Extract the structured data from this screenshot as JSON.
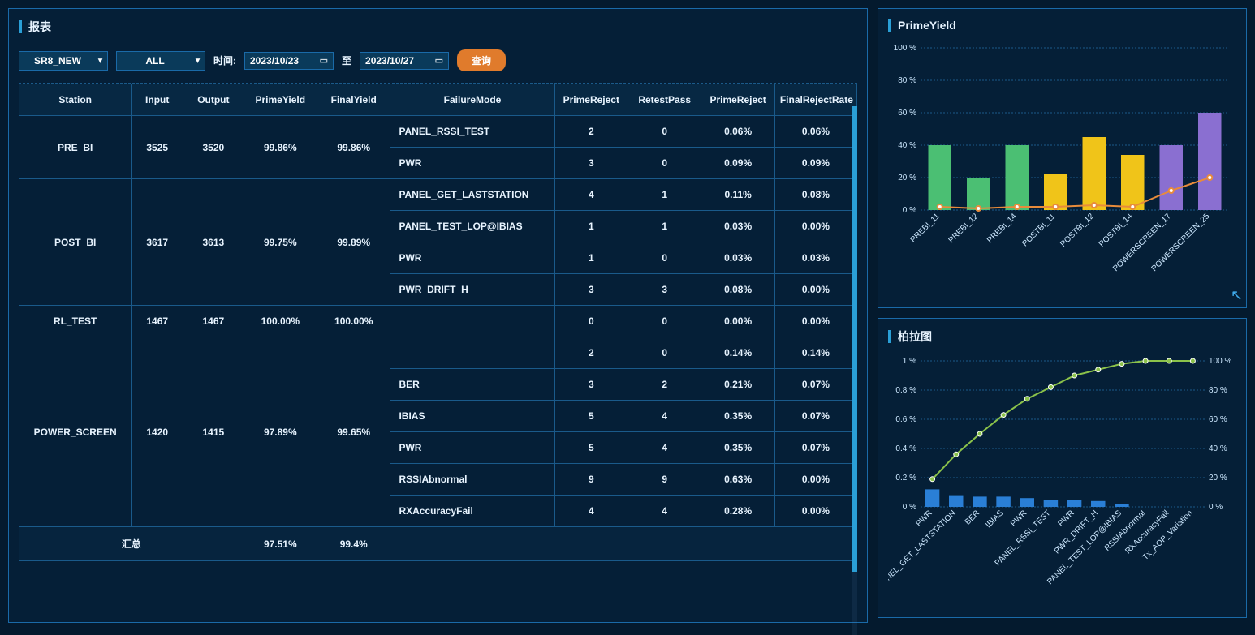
{
  "report": {
    "title": "报表",
    "filters": {
      "source": "SR8_NEW",
      "scope": "ALL",
      "time_label": "时间:",
      "date_from": "2023/10/23",
      "date_sep": "至",
      "date_to": "2023/10/27",
      "query_btn": "查询"
    },
    "columns": [
      "Station",
      "Input",
      "Output",
      "PrimeYield",
      "FinalYield",
      "FailureMode",
      "PrimeReject",
      "RetestPass",
      "PrimeReject",
      "FinalRejectRate"
    ],
    "rows": [
      {
        "station": "PRE_BI",
        "input": "3525",
        "output": "3520",
        "prime_yield": "99.86%",
        "final_yield": "99.86%",
        "details": [
          {
            "fm": "PANEL_RSSI_TEST",
            "pr": "2",
            "rp": "0",
            "pr2": "0.06%",
            "frr": "0.06%"
          },
          {
            "fm": "PWR",
            "pr": "3",
            "rp": "0",
            "pr2": "0.09%",
            "frr": "0.09%"
          }
        ]
      },
      {
        "station": "POST_BI",
        "input": "3617",
        "output": "3613",
        "prime_yield": "99.75%",
        "final_yield": "99.89%",
        "details": [
          {
            "fm": "PANEL_GET_LASTSTATION",
            "pr": "4",
            "rp": "1",
            "pr2": "0.11%",
            "frr": "0.08%"
          },
          {
            "fm": "PANEL_TEST_LOP@IBIAS",
            "pr": "1",
            "rp": "1",
            "pr2": "0.03%",
            "frr": "0.00%"
          },
          {
            "fm": "PWR",
            "pr": "1",
            "rp": "0",
            "pr2": "0.03%",
            "frr": "0.03%"
          },
          {
            "fm": "PWR_DRIFT_H",
            "pr": "3",
            "rp": "3",
            "pr2": "0.08%",
            "frr": "0.00%"
          }
        ]
      },
      {
        "station": "RL_TEST",
        "input": "1467",
        "output": "1467",
        "prime_yield": "100.00%",
        "final_yield": "100.00%",
        "details": [
          {
            "fm": "",
            "pr": "0",
            "rp": "0",
            "pr2": "0.00%",
            "frr": "0.00%"
          }
        ]
      },
      {
        "station": "POWER_SCREEN",
        "input": "1420",
        "output": "1415",
        "prime_yield": "97.89%",
        "final_yield": "99.65%",
        "details": [
          {
            "fm": "",
            "pr": "2",
            "rp": "0",
            "pr2": "0.14%",
            "frr": "0.14%"
          },
          {
            "fm": "BER",
            "pr": "3",
            "rp": "2",
            "pr2": "0.21%",
            "frr": "0.07%"
          },
          {
            "fm": "IBIAS",
            "pr": "5",
            "rp": "4",
            "pr2": "0.35%",
            "frr": "0.07%"
          },
          {
            "fm": "PWR",
            "pr": "5",
            "rp": "4",
            "pr2": "0.35%",
            "frr": "0.07%"
          },
          {
            "fm": "RSSIAbnormal",
            "pr": "9",
            "rp": "9",
            "pr2": "0.63%",
            "frr": "0.00%"
          },
          {
            "fm": "RXAccuracyFail",
            "pr": "4",
            "rp": "4",
            "pr2": "0.28%",
            "frr": "0.00%"
          }
        ]
      }
    ],
    "summary": {
      "station": "汇总",
      "input": "",
      "output": "",
      "prime_yield": "97.51%",
      "final_yield": "99.4%"
    }
  },
  "chart1": {
    "title": "PrimeYield"
  },
  "chart2": {
    "title": "柏拉图"
  },
  "chart_data": [
    {
      "type": "bar+line",
      "title": "PrimeYield",
      "categories": [
        "PREBI_11",
        "PREBI_12",
        "PREBI_14",
        "POSTBI_11",
        "POSTBI_12",
        "POSTBI_14",
        "POWERSCREEN_17",
        "POWERSCREEN_25"
      ],
      "series": [
        {
          "name": "bar",
          "values": [
            40,
            20,
            40,
            22,
            45,
            34,
            40,
            60
          ],
          "colors": [
            "#4bbf73",
            "#4bbf73",
            "#4bbf73",
            "#f0c419",
            "#f0c419",
            "#f0c419",
            "#8a6fd1",
            "#8a6fd1"
          ]
        },
        {
          "name": "line",
          "values": [
            2,
            1,
            2,
            2,
            3,
            2,
            12,
            20
          ],
          "color": "#e88b3b"
        }
      ],
      "ylabel": "%",
      "ylim": [
        0,
        100
      ],
      "yticks": [
        0,
        20,
        40,
        60,
        80,
        100
      ]
    },
    {
      "type": "pareto",
      "title": "柏拉图",
      "categories": [
        "PWR",
        "PANEL_GET_LASTSTATION",
        "BER",
        "IBIAS",
        "PWR",
        "PANEL_RSSI_TEST",
        "PWR",
        "PWR_DRIFT_H",
        "PANEL_TEST_LOP@IBIAS",
        "RSSIAbnormal",
        "RXAccuracyFail",
        "Tx_AOP_Variation"
      ],
      "series": [
        {
          "name": "bar",
          "values": [
            0.12,
            0.08,
            0.07,
            0.07,
            0.06,
            0.05,
            0.05,
            0.04,
            0.02,
            0.0,
            0.0,
            0.0
          ],
          "color": "#2a7fd6"
        },
        {
          "name": "cumulative",
          "values": [
            19,
            36,
            50,
            63,
            74,
            82,
            90,
            94,
            98,
            100,
            100,
            100
          ],
          "color": "#8bc24a"
        }
      ],
      "ylim_left": [
        0,
        1
      ],
      "yticks_left": [
        0,
        0.2,
        0.4,
        0.6,
        0.8,
        1
      ],
      "ylabel_left": "%",
      "ylim_right": [
        0,
        100
      ],
      "yticks_right": [
        0,
        20,
        40,
        60,
        80,
        100
      ],
      "ylabel_right": "%"
    }
  ]
}
